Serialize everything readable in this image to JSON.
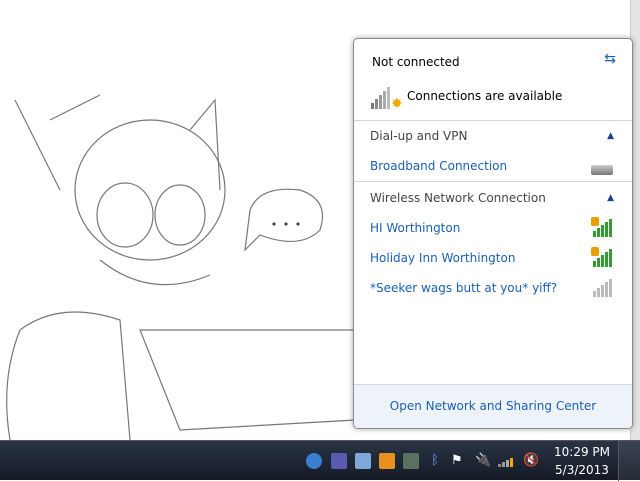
{
  "panel": {
    "status_title": "Not connected",
    "status_detail": "Connections are available",
    "sections": [
      {
        "label": "Dial-up and VPN",
        "items": [
          {
            "name": "Broadband Connection",
            "icon": "modem-icon"
          }
        ]
      },
      {
        "label": "Wireless Network Connection",
        "items": [
          {
            "name": "HI Worthington",
            "secured": true,
            "signal": 5
          },
          {
            "name": "Holiday Inn Worthington",
            "secured": true,
            "signal": 5
          },
          {
            "name": "*Seeker wags butt at you* yiff?",
            "secured": false,
            "signal": 5
          }
        ]
      }
    ],
    "footer_link": "Open Network and Sharing Center"
  },
  "taskbar": {
    "time": "10:29 PM",
    "date": "5/3/2013"
  },
  "colors": {
    "link": "#1a5fb4",
    "signal": "#2e9e2e",
    "taskbar": "#1c2430"
  }
}
